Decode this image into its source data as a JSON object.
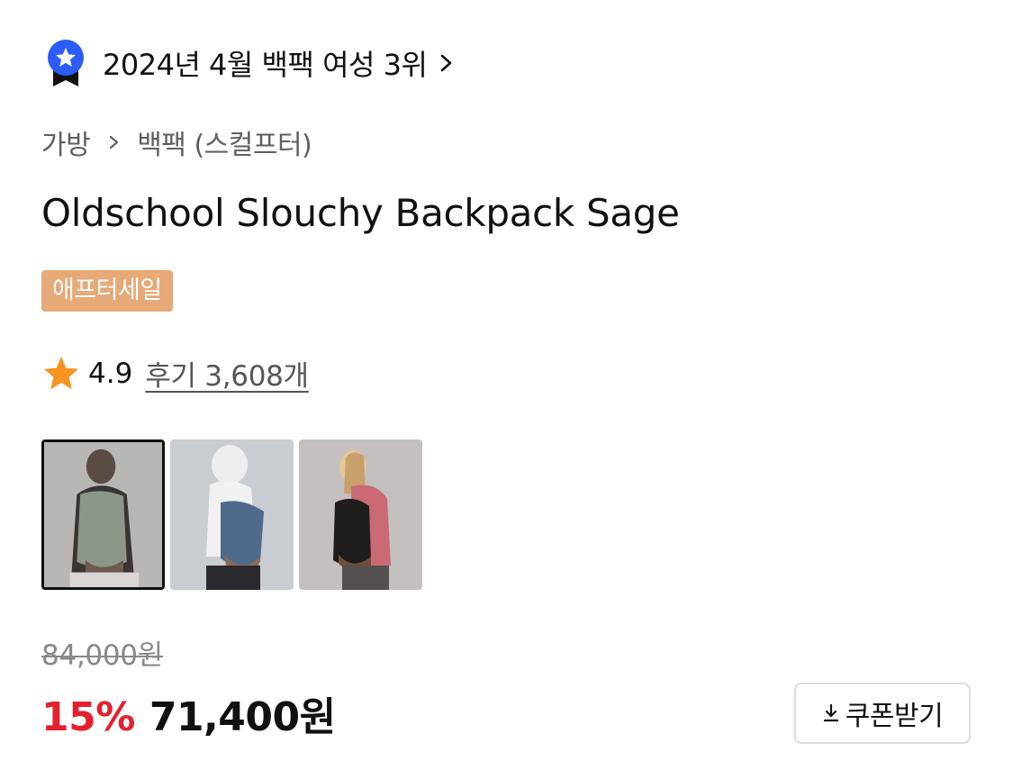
{
  "ranking": {
    "text": "2024년 4월 백팩 여성 3위",
    "badge_color": "#2b5cf6",
    "chevron_icon": "chevron-right-icon"
  },
  "breadcrumb": {
    "category": "가방",
    "subcategory": "백팩 (스컬프터)"
  },
  "product": {
    "title": "Oldschool Slouchy Backpack Sage",
    "sale_badge": "애프터세일",
    "sale_badge_color": "#e6a978"
  },
  "rating": {
    "score": "4.9",
    "review_link": "후기 3,608개",
    "star_color": "#f7931e"
  },
  "thumbnails": [
    {
      "alt": "sage backpack",
      "selected": true
    },
    {
      "alt": "denim backpack",
      "selected": false
    },
    {
      "alt": "black backpack",
      "selected": false
    }
  ],
  "price": {
    "original": "84,000원",
    "discount": "15%",
    "sale": "71,400원",
    "discount_color": "#e5202e"
  },
  "coupon": {
    "label": "쿠폰받기",
    "icon": "download-icon"
  }
}
